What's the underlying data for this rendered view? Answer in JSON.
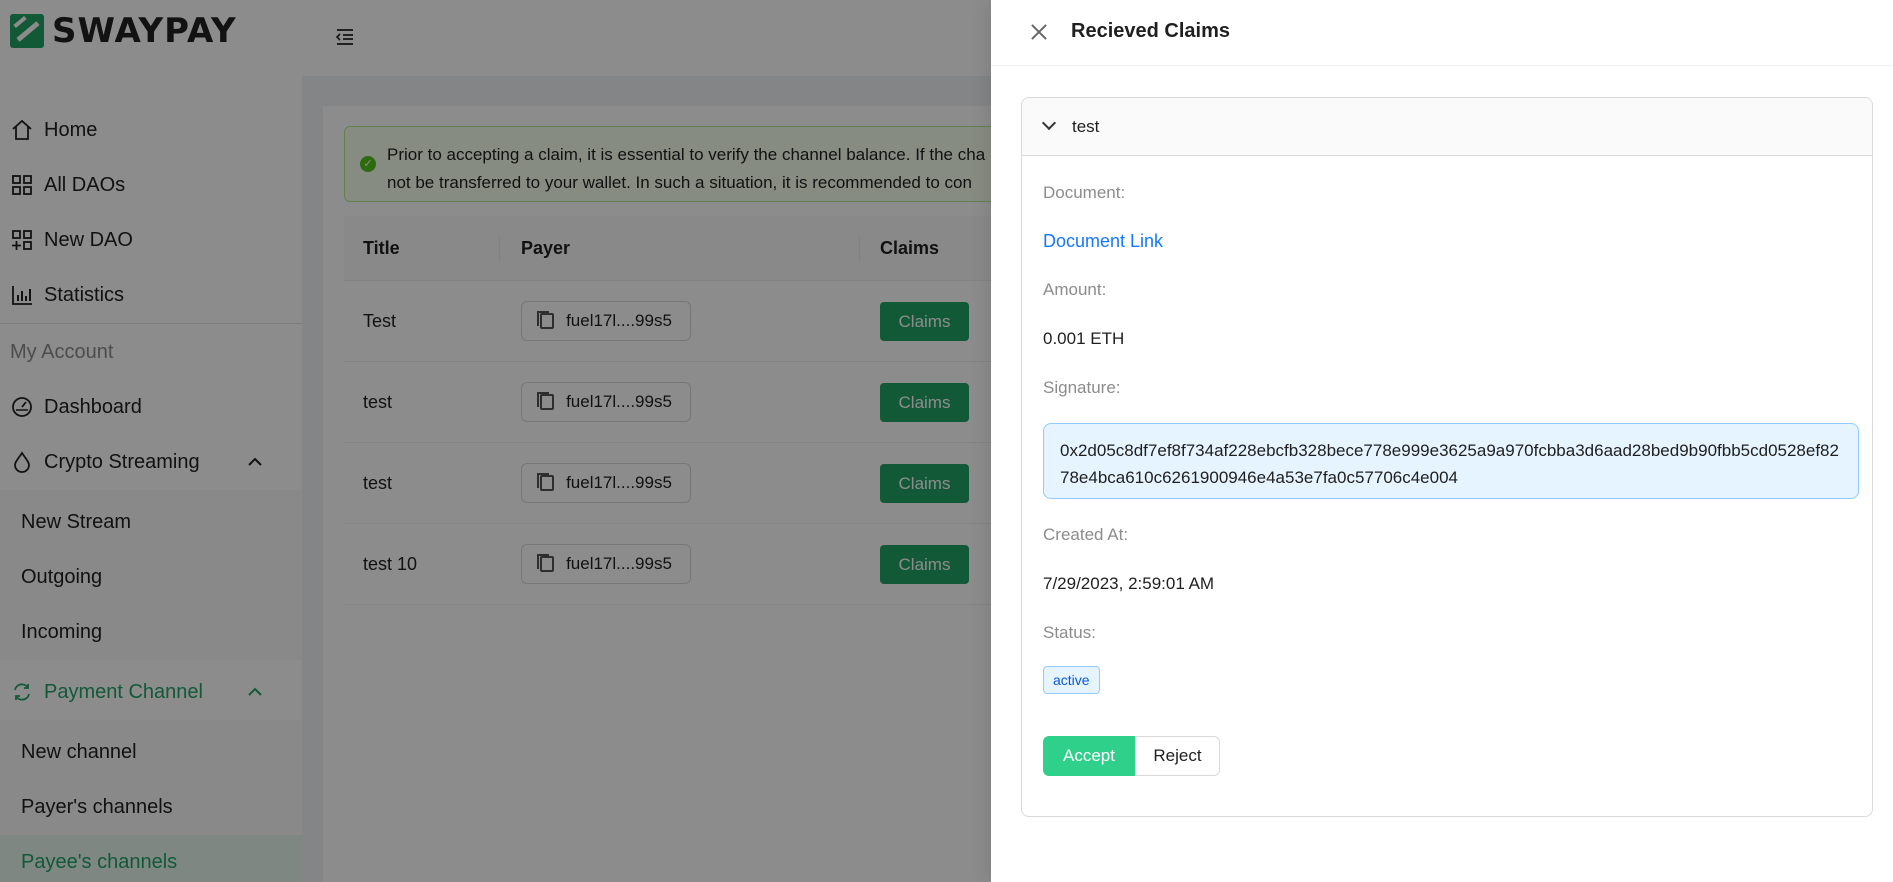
{
  "brand": {
    "name": "SWAYPAY"
  },
  "sidebar": {
    "home": "Home",
    "all_daos": "All DAOs",
    "new_dao": "New DAO",
    "statistics": "Statistics",
    "my_account": "My Account",
    "dashboard": "Dashboard",
    "crypto_streaming": "Crypto Streaming",
    "streaming_items": [
      "New Stream",
      "Outgoing",
      "Incoming"
    ],
    "payment_channel": "Payment Channel",
    "channel_items": [
      "New channel",
      "Payer's channels",
      "Payee's channels"
    ]
  },
  "alert": {
    "line1": "Prior to accepting a claim, it is essential to verify the channel balance. If the cha",
    "line2": "not be transferred to your wallet. In such a situation, it is recommended to con"
  },
  "table": {
    "headers": [
      "Title",
      "Payer",
      "Claims"
    ],
    "rows": [
      {
        "title": "Test",
        "payer": "fuel17l....99s5",
        "claims": "Claims"
      },
      {
        "title": "test",
        "payer": "fuel17l....99s5",
        "claims": "Claims"
      },
      {
        "title": "test",
        "payer": "fuel17l....99s5",
        "claims": "Claims"
      },
      {
        "title": "test 10",
        "payer": "fuel17l....99s5",
        "claims": "Claims"
      }
    ]
  },
  "drawer": {
    "title": "Recieved Claims",
    "panel_title": "test",
    "document_label": "Document:",
    "document_link": "Document Link",
    "amount_label": "Amount:",
    "amount_value": "0.001 ETH",
    "signature_label": "Signature:",
    "signature_value": "0x2d05c8df7ef8f734af228ebcfb328bece778e999e3625a9a970fcbba3d6aad28bed9b90fbb5cd0528ef8278e4bca610c6261900946e4a53e7fa0c57706c4e004",
    "created_label": "Created At:",
    "created_value": "7/29/2023, 2:59:01 AM",
    "status_label": "Status:",
    "status_value": "active",
    "accept_label": "Accept",
    "reject_label": "Reject"
  },
  "colors": {
    "brand_green": "#21a366",
    "accept_green": "#2fd18a",
    "link_blue": "#1677ff",
    "tag_blue": "#e6f4ff"
  }
}
